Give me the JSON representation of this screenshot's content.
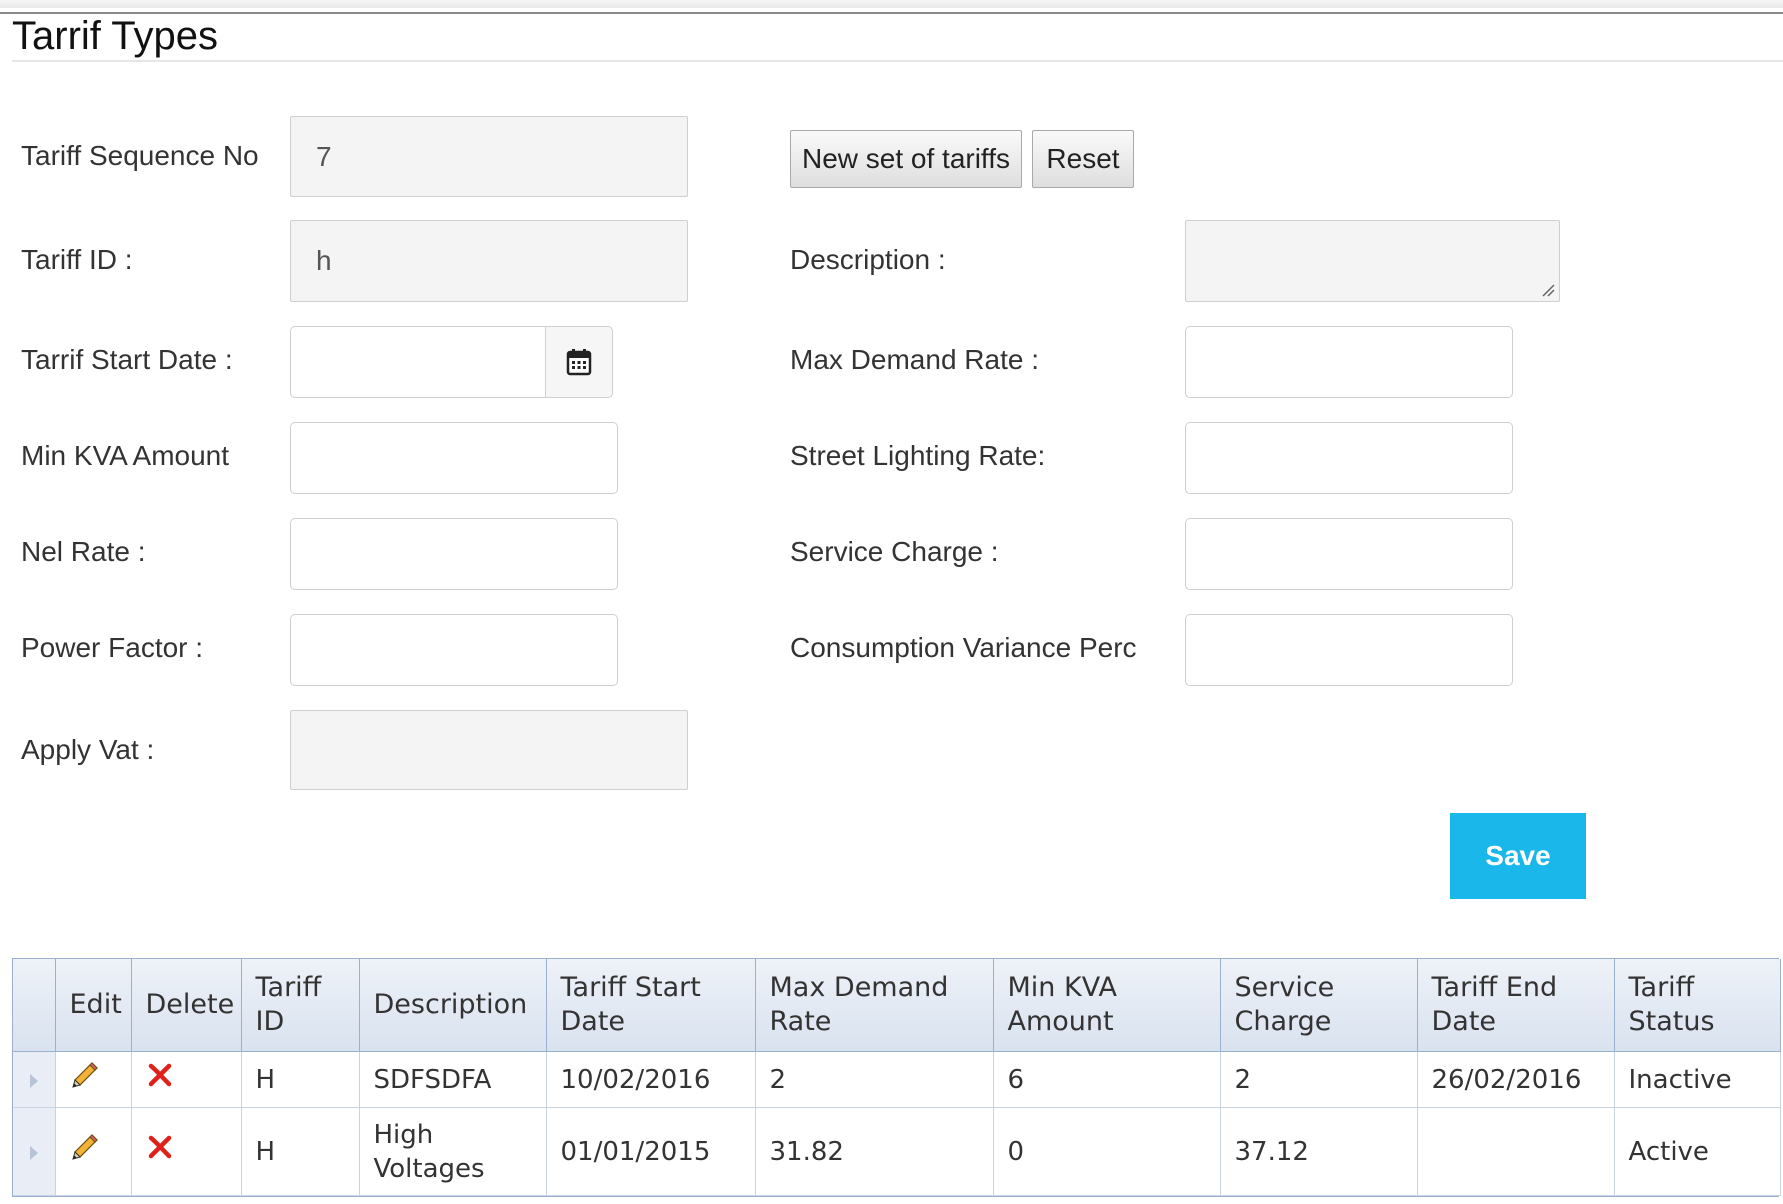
{
  "page": {
    "title": "Tarrif Types"
  },
  "form": {
    "sequence_label": "Tariff Sequence No",
    "sequence_value": "7",
    "tariff_id_label": "Tariff ID :",
    "tariff_id_value": "h",
    "start_date_label": "Tarrif Start Date :",
    "start_date_value": "",
    "min_kva_label": "Min KVA Amount",
    "nel_rate_label": "Nel Rate :",
    "power_factor_label": "Power Factor :",
    "apply_vat_label": "Apply Vat :",
    "description_label": "Description :",
    "max_demand_label": "Max Demand Rate :",
    "street_lighting_label": "Street Lighting Rate:",
    "service_charge_label": "Service Charge :",
    "consumption_variance_label": "Consumption Variance Perc"
  },
  "buttons": {
    "new_set": "New set of tariffs",
    "reset": "Reset",
    "save": "Save"
  },
  "icons": {
    "calendar": "calendar-icon",
    "edit": "pencil-icon",
    "delete": "red-x-icon",
    "expand": "triangle-right-icon"
  },
  "colors": {
    "save_button": "#1ab7ea",
    "grid_header": "#d9e2ef",
    "grid_border": "#9ab0cf",
    "delete_icon": "#e0201a"
  },
  "table": {
    "headers": {
      "edit": "Edit",
      "delete": "Delete",
      "tariff_id_1": "Tariff",
      "tariff_id_2": "ID",
      "description": "Description",
      "start_1": "Tariff Start",
      "start_2": "Date",
      "max_1": "Max Demand",
      "max_2": "Rate",
      "kva_1": "Min KVA",
      "kva_2": "Amount",
      "service_1": "Service",
      "service_2": "Charge",
      "end_1": "Tariff End",
      "end_2": "Date",
      "status_1": "Tariff",
      "status_2": "Status"
    },
    "rows": [
      {
        "tariff_id": "H",
        "description_1": "SDFSDFA",
        "description_2": "",
        "start_date": "10/02/2016",
        "max_demand": "2",
        "min_kva": "6",
        "service_charge": "2",
        "end_date": "26/02/2016",
        "status": "Inactive"
      },
      {
        "tariff_id": "H",
        "description_1": "High",
        "description_2": "Voltages",
        "start_date": "01/01/2015",
        "max_demand": "31.82",
        "min_kva": "0",
        "service_charge": "37.12",
        "end_date": "",
        "status": "Active"
      }
    ]
  }
}
